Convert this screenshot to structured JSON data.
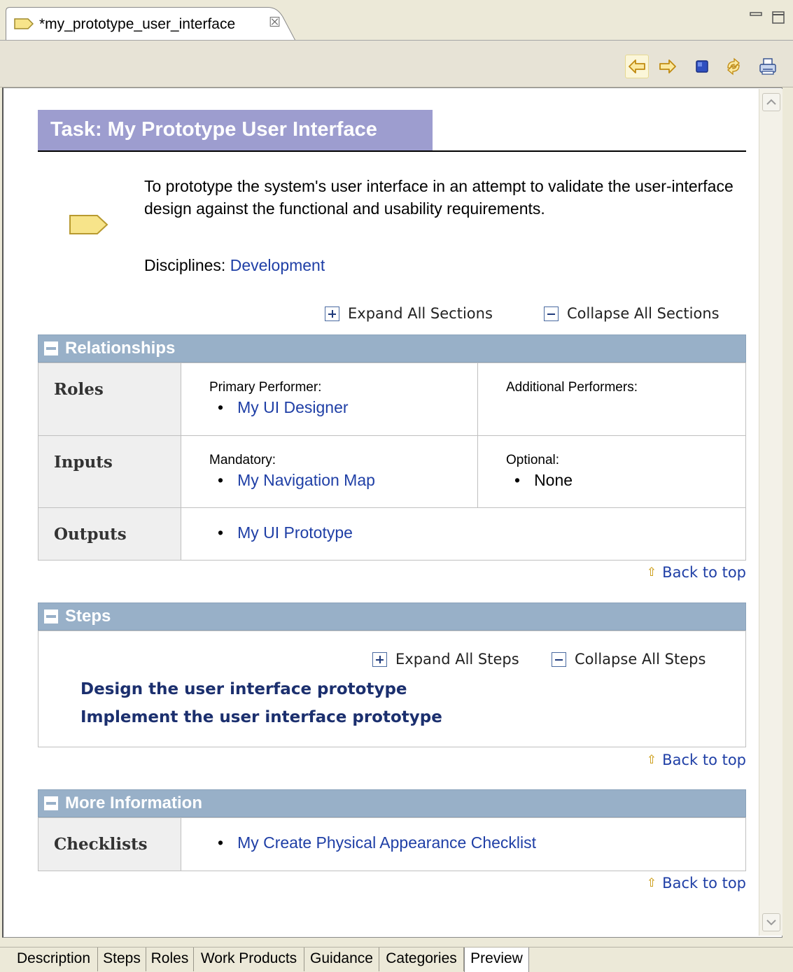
{
  "editor": {
    "tab_title": "*my_prototype_user_interface",
    "close_glyph": "☒"
  },
  "toolbar": {
    "buttons": [
      "back-arrow-icon",
      "forward-arrow-icon",
      "stop-icon",
      "refresh-icon",
      "print-icon"
    ]
  },
  "page": {
    "title": "Task: My Prototype User Interface",
    "description_line1": "To prototype the system's user interface in an attempt to validate the user-interface",
    "description_line2": "design against the functional and usability requirements.",
    "disciplines_label": "Disciplines:",
    "disciplines_link": "Development",
    "expand_all_sections": "Expand All Sections",
    "collapse_all_sections": "Collapse All Sections",
    "back_to_top": "Back to top"
  },
  "relationships": {
    "header": "Relationships",
    "roles": {
      "label": "Roles",
      "primary_label": "Primary Performer:",
      "primary_item": "My UI Designer",
      "additional_label": "Additional Performers:"
    },
    "inputs": {
      "label": "Inputs",
      "mandatory_label": "Mandatory:",
      "mandatory_item": "My Navigation Map",
      "optional_label": "Optional:",
      "optional_item": "None"
    },
    "outputs": {
      "label": "Outputs",
      "item": "My UI Prototype"
    }
  },
  "steps": {
    "header": "Steps",
    "expand_all": "Expand All Steps",
    "collapse_all": "Collapse All Steps",
    "items": [
      "Design the user interface prototype",
      "Implement the user interface prototype"
    ]
  },
  "more_info": {
    "header": "More Information",
    "checklists_label": "Checklists",
    "checklist_item": "My Create Physical Appearance Checklist"
  },
  "bottom_tabs": [
    "Description",
    "Steps",
    "Roles",
    "Work Products",
    "Guidance",
    "Categories",
    "Preview"
  ],
  "selected_bottom_tab": "Preview",
  "colors": {
    "title_bg": "#9d9dcf",
    "section_header_bg": "#98b0c8",
    "link": "#1f3fa6",
    "task_icon": "#f7e48a"
  }
}
